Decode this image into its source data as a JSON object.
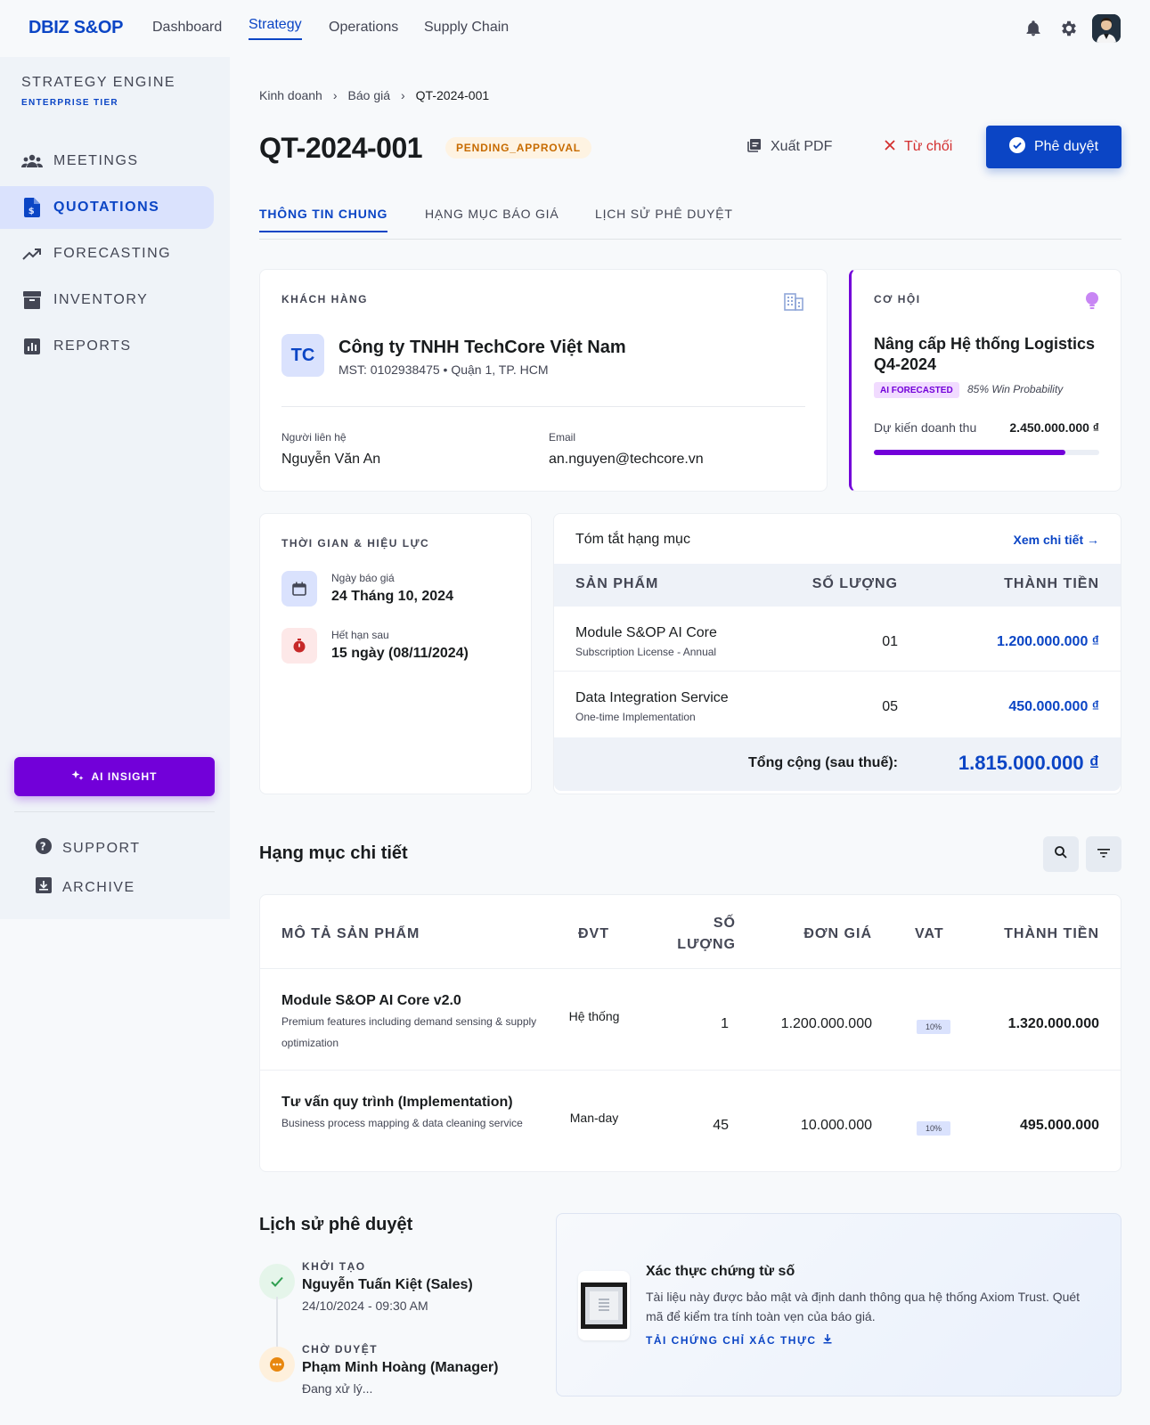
{
  "topbar": {
    "brand": "DBIZ S&OP",
    "nav": [
      "Dashboard",
      "Strategy",
      "Operations",
      "Supply Chain"
    ],
    "active_nav": "Strategy"
  },
  "sidebar": {
    "title": "STRATEGY ENGINE",
    "tier": "ENTERPRISE TIER",
    "items": [
      {
        "label": "MEETINGS",
        "icon": "group-icon"
      },
      {
        "label": "QUOTATIONS",
        "icon": "document-dollar-icon"
      },
      {
        "label": "FORECASTING",
        "icon": "trending-up-icon"
      },
      {
        "label": "INVENTORY",
        "icon": "archive-box-icon"
      },
      {
        "label": "REPORTS",
        "icon": "bar-chart-icon"
      }
    ],
    "active_item": "QUOTATIONS",
    "ai_button": "AI INSIGHT",
    "footer": [
      {
        "label": "SUPPORT",
        "icon": "help-icon"
      },
      {
        "label": "ARCHIVE",
        "icon": "archive-down-icon"
      }
    ]
  },
  "breadcrumb": [
    "Kinh doanh",
    "Báo giá",
    "QT-2024-001"
  ],
  "quote": {
    "id": "QT-2024-001",
    "status": "PENDING_APPROVAL",
    "actions": {
      "export": "Xuất PDF",
      "reject": "Từ chối",
      "approve": "Phê duyệt"
    }
  },
  "tabs": [
    "THÔNG TIN CHUNG",
    "HẠNG MỤC BÁO GIÁ",
    "LỊCH SỬ PHÊ DUYỆT"
  ],
  "active_tab": "THÔNG TIN CHUNG",
  "customer": {
    "label": "KHÁCH HÀNG",
    "initials": "TC",
    "name": "Công ty TNHH TechCore Việt Nam",
    "sub": "MST: 0102938475 • Quận 1, TP. HCM",
    "contact_label": "Người liên hệ",
    "contact": "Nguyễn Văn An",
    "email_label": "Email",
    "email": "an.nguyen@techcore.vn"
  },
  "opportunity": {
    "label": "CƠ HỘI",
    "title": "Nâng cấp Hệ thống Logistics Q4-2024",
    "ai_tag": "AI FORECASTED",
    "probability_text": "85% Win Probability",
    "revenue_label": "Dự kiến doanh thu",
    "revenue": "2.450.000.000 ₫",
    "progress_fraction": 0.85
  },
  "timing": {
    "label": "THỜI GIAN & HIỆU LỰC",
    "date_label": "Ngày báo giá",
    "date": "24 Tháng 10, 2024",
    "expiry_label": "Hết hạn sau",
    "expiry": "15 ngày (08/11/2024)"
  },
  "summary": {
    "title": "Tóm tắt hạng mục",
    "link": "Xem chi tiết →",
    "headers": {
      "product": "SẢN PHẨM",
      "qty": "SỐ LƯỢNG",
      "amount": "THÀNH TIỀN"
    },
    "rows": [
      {
        "name": "Module S&OP AI Core",
        "desc": "Subscription License - Annual",
        "qty": "01",
        "amount": "1.200.000.000 ₫"
      },
      {
        "name": "Data Integration Service",
        "desc": "One-time Implementation",
        "qty": "05",
        "amount": "450.000.000 ₫"
      }
    ],
    "total_label": "Tổng cộng (sau thuế):",
    "total": "1.815.000.000 ₫"
  },
  "detail": {
    "title": "Hạng mục chi tiết",
    "headers": {
      "desc": "MÔ TẢ SẢN PHẨM",
      "unit": "ĐVT",
      "qty": "SỐ LƯỢNG",
      "price": "ĐƠN GIÁ",
      "vat": "VAT",
      "amount": "THÀNH TIỀN"
    },
    "rows": [
      {
        "name": "Module S&OP AI Core v2.0",
        "desc": "Premium features including demand sensing & supply optimization",
        "unit": "Hệ thống",
        "qty": "1",
        "price": "1.200.000.000",
        "vat": "10%",
        "amount": "1.320.000.000"
      },
      {
        "name": "Tư vấn quy trình (Implementation)",
        "desc": "Business process mapping & data cleaning service",
        "unit": "Man-day",
        "qty": "45",
        "price": "10.000.000",
        "vat": "10%",
        "amount": "495.000.000"
      }
    ]
  },
  "history": {
    "title": "Lịch sử phê duyệt",
    "steps": [
      {
        "step": "KHỞI TẠO",
        "who": "Nguyễn Tuấn Kiệt (Sales)",
        "when": "24/10/2024 - 09:30 AM"
      },
      {
        "step": "CHỜ DUYỆT",
        "who": "Phạm Minh Hoàng (Manager)",
        "when": "Đang xử lý..."
      }
    ]
  },
  "verify": {
    "title": "Xác thực chứng từ số",
    "body": "Tài liệu này được bảo mật và định danh thông qua hệ thống Axiom Trust. Quét mã để kiểm tra tính toàn vẹn của báo giá.",
    "link": "TẢI CHỨNG CHỈ XÁC THỰC"
  },
  "colors": {
    "primary": "#0b45c5",
    "ai": "#7200d9",
    "warning": "#c76b00",
    "danger": "#d32f2f",
    "success": "#2e9e4f"
  }
}
